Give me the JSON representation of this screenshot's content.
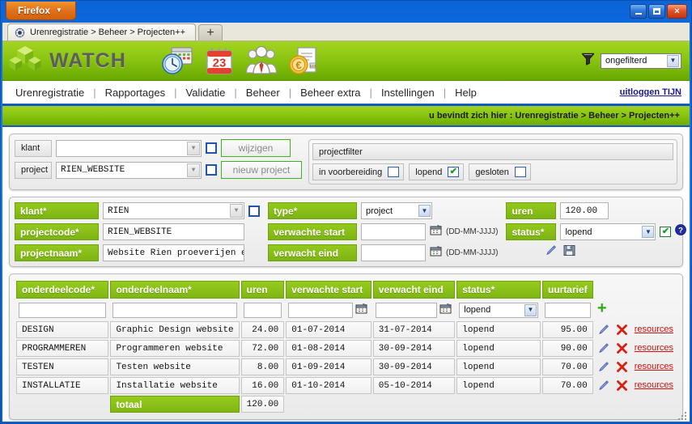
{
  "window": {
    "firefox_button": "Firefox",
    "minimize_label": "minimize",
    "maximize_label": "maximize",
    "close_label": "×"
  },
  "browser": {
    "tab_title": "Urenregistratie > Beheer > Projecten++",
    "new_tab_label": "+"
  },
  "app_header": {
    "brand": "WATCH",
    "icons": [
      "clock-schedule-icon",
      "calendar-23-icon",
      "team-people-icon",
      "euro-invoice-icon"
    ],
    "calendar_day": "23",
    "filter_icon": "funnel-filter-icon",
    "filter_value": "ongefilterd"
  },
  "nav": {
    "items": [
      "Urenregistratie",
      "Rapportages",
      "Validatie",
      "Beheer",
      "Beheer extra",
      "Instellingen",
      "Help"
    ],
    "separator": "|",
    "logout": "uitloggen TIJN"
  },
  "breadcrumb": {
    "text": "u bevindt zich hier : Urenregistratie > Beheer > Projecten++"
  },
  "filter_panel": {
    "klant_label": "klant",
    "klant_value": "",
    "project_label": "project",
    "project_value": "RIEN_WEBSITE",
    "wijzigen_button": "wijzigen",
    "nieuw_project_button": "nieuw project",
    "projectfilter_label": "projectfilter",
    "status_filters": [
      {
        "label": "in voorbereiding",
        "checked": false
      },
      {
        "label": "lopend",
        "checked": true
      },
      {
        "label": "gesloten",
        "checked": false
      }
    ]
  },
  "project_detail": {
    "klant_label": "klant*",
    "klant_value": "RIEN",
    "projectcode_label": "projectcode*",
    "projectcode_value": "RIEN_WEBSITE",
    "projectnaam_label": "projectnaam*",
    "projectnaam_value": "Website Rien proeverijen en a",
    "type_label": "type*",
    "type_value": "project",
    "verwachte_start_label": "verwachte start",
    "verwachte_start_value": "",
    "verwacht_eind_label": "verwacht eind",
    "verwacht_eind_value": "",
    "date_hint": "(DD-MM-JJJJ)",
    "uren_label": "uren",
    "uren_value": "120.00",
    "status_label": "status*",
    "status_value": "lopend",
    "confirm_checked": true,
    "help_icon": "question-help-icon",
    "edit_icon": "pencil-edit-icon",
    "save_icon": "floppy-save-icon",
    "calendar_icon": "calendar-picker-icon"
  },
  "table": {
    "columns": [
      "onderdeelcode*",
      "onderdeelnaam*",
      "uren",
      "verwachte start",
      "verwacht eind",
      "status*",
      "uurtarief"
    ],
    "new_row": {
      "onderdeelcode": "",
      "onderdeelnaam": "",
      "uren": "",
      "verwachte_start": "",
      "verwacht_eind": "",
      "status": "lopend",
      "uurtarief": "",
      "add_icon": "plus-add-icon"
    },
    "rows": [
      {
        "onderdeelcode": "DESIGN",
        "onderdeelnaam": "Graphic Design website",
        "uren": "24.00",
        "verwachte_start": "01-07-2014",
        "verwacht_eind": "31-07-2014",
        "status": "lopend",
        "uurtarief": "95.00",
        "resources": "resources"
      },
      {
        "onderdeelcode": "PROGRAMMEREN",
        "onderdeelnaam": "Programmeren website",
        "uren": "72.00",
        "verwachte_start": "01-08-2014",
        "verwacht_eind": "30-09-2014",
        "status": "lopend",
        "uurtarief": "90.00",
        "resources": "resources"
      },
      {
        "onderdeelcode": "TESTEN",
        "onderdeelnaam": "Testen website",
        "uren": "8.00",
        "verwachte_start": "01-09-2014",
        "verwacht_eind": "30-09-2014",
        "status": "lopend",
        "uurtarief": "70.00",
        "resources": "resources"
      },
      {
        "onderdeelcode": "INSTALLATIE",
        "onderdeelnaam": "Installatie website",
        "uren": "16.00",
        "verwachte_start": "01-10-2014",
        "verwacht_eind": "05-10-2014",
        "status": "lopend",
        "uurtarief": "70.00",
        "resources": "resources"
      }
    ],
    "total_label": "totaal",
    "total_value": "120.00",
    "edit_icon": "pencil-edit-icon",
    "delete_icon": "red-x-delete-icon"
  },
  "colors": {
    "brand_green": "#8dc713",
    "header_blue": "#1357c8",
    "accent_orange": "#e2711a",
    "danger_red": "#d01010"
  }
}
